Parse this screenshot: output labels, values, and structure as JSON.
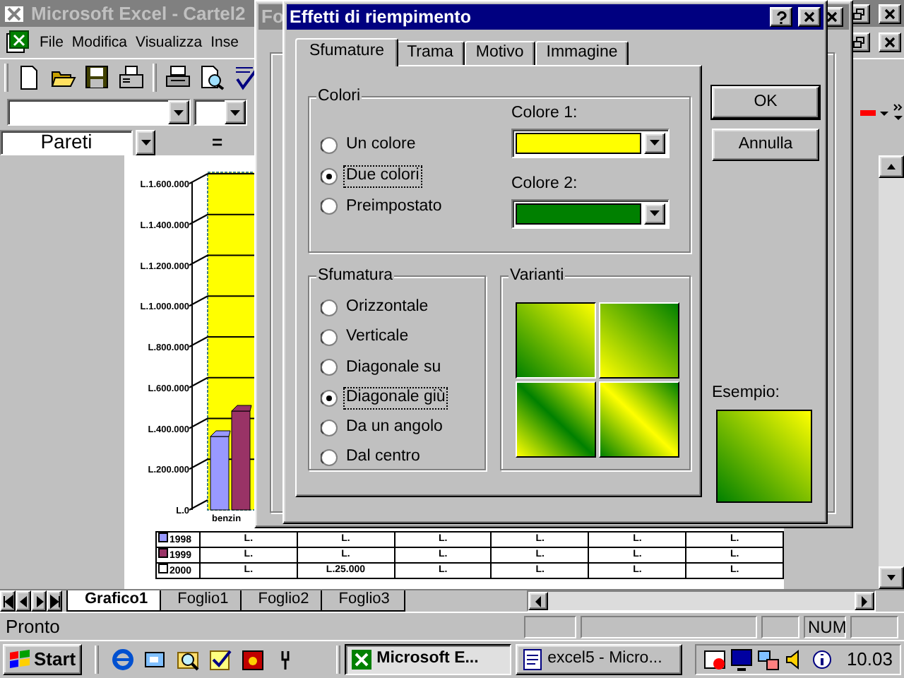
{
  "excel_window": {
    "title": "Microsoft Excel - Cartel2",
    "menu": [
      "File",
      "Modifica",
      "Visualizza",
      "Inse"
    ],
    "name_box": "Pareti",
    "formula_sign": "=",
    "chart": {
      "y_axis_labels": [
        "L.1.600.000",
        "L.1.400.000",
        "L.1.200.000",
        "L.1.000.000",
        "L.800.000",
        "L.600.000",
        "L.400.000",
        "L.200.000",
        "L.0"
      ],
      "category_label": "benzin"
    },
    "data_table": {
      "rows": [
        {
          "label": "1998",
          "color": "#9999ff",
          "cells": [
            "L.",
            "L.",
            "L.",
            "L.",
            "L.",
            "L."
          ]
        },
        {
          "label": "1999",
          "color": "#993366",
          "cells": [
            "L.",
            "L.",
            "L.",
            "L.",
            "L.",
            "L."
          ]
        },
        {
          "label": "2000",
          "color": "#ffffff",
          "cells": [
            "L.",
            "L.25.000",
            "L.",
            "L.",
            "L.",
            "L."
          ]
        }
      ]
    },
    "sheet_tabs": [
      {
        "label": "Grafico1",
        "selected": true
      },
      {
        "label": "Foglio1",
        "selected": false
      },
      {
        "label": "Foglio2",
        "selected": false
      },
      {
        "label": "Foglio3",
        "selected": false
      }
    ],
    "status_bar": {
      "text": "Pronto",
      "indicators": [
        "NUM"
      ]
    }
  },
  "back_dialog": {
    "title": "Fo"
  },
  "dialog": {
    "title": "Effetti di riempimento",
    "tabs": [
      {
        "label": "Sfumature",
        "selected": true
      },
      {
        "label": "Trama",
        "selected": false
      },
      {
        "label": "Motivo",
        "selected": false
      },
      {
        "label": "Immagine",
        "selected": false
      }
    ],
    "colors_group": {
      "label": "Colori",
      "options": [
        {
          "label": "Un colore",
          "selected": false
        },
        {
          "label": "Due colori",
          "selected": true
        },
        {
          "label": "Preimpostato",
          "selected": false
        }
      ],
      "color_fields": [
        {
          "label": "Colore 1:",
          "color": "#ffff00"
        },
        {
          "label": "Colore 2:",
          "color": "#008000"
        }
      ]
    },
    "shading_group": {
      "label": "Sfumatura",
      "options": [
        {
          "label": "Orizzontale",
          "selected": false
        },
        {
          "label": "Verticale",
          "selected": false
        },
        {
          "label": "Diagonale su",
          "selected": false
        },
        {
          "label": "Diagonale giù",
          "selected": true
        },
        {
          "label": "Da un angolo",
          "selected": false
        },
        {
          "label": "Dal centro",
          "selected": false
        }
      ]
    },
    "variants_group": {
      "label": "Varianti",
      "variants": [
        {
          "selected": true
        },
        {
          "selected": false
        },
        {
          "selected": false
        },
        {
          "selected": false
        }
      ]
    },
    "buttons": [
      "OK",
      "Annulla"
    ],
    "sample_label": "Esempio:"
  },
  "taskbar": {
    "start": "Start",
    "tasks": [
      {
        "label": "Microsoft E...",
        "selected": true
      },
      {
        "label": "excel5 - Micro...",
        "selected": false
      }
    ],
    "clock": "10.03"
  }
}
